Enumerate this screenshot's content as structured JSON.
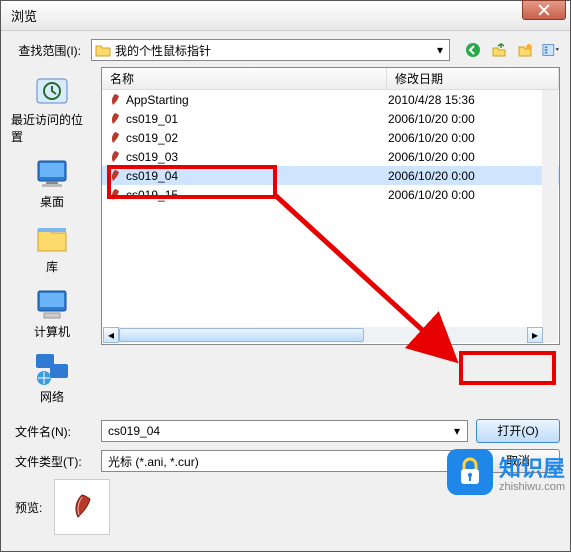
{
  "dialog": {
    "title": "浏览",
    "lookin_label": "查找范围(I):",
    "folder_name": "我的个性鼠标指针",
    "columns": {
      "name": "名称",
      "date": "修改日期"
    },
    "files": [
      {
        "name": "AppStarting",
        "date": "2010/4/28 15:36"
      },
      {
        "name": "cs019_01",
        "date": "2006/10/20 0:00"
      },
      {
        "name": "cs019_02",
        "date": "2006/10/20 0:00"
      },
      {
        "name": "cs019_03",
        "date": "2006/10/20 0:00"
      },
      {
        "name": "cs019_04",
        "date": "2006/10/20 0:00"
      },
      {
        "name": "cs019_15",
        "date": "2006/10/20 0:00"
      }
    ],
    "selected_index": 4,
    "filename_label": "文件名(N):",
    "filename_value": "cs019_04",
    "filetype_label": "文件类型(T):",
    "filetype_value": "光标 (*.ani, *.cur)",
    "open_label": "打开(O)",
    "cancel_label": "取消",
    "preview_label": "预览:"
  },
  "places": [
    {
      "key": "recent",
      "label": "最近访问的位置"
    },
    {
      "key": "desktop",
      "label": "桌面"
    },
    {
      "key": "library",
      "label": "库"
    },
    {
      "key": "computer",
      "label": "计算机"
    },
    {
      "key": "network",
      "label": "网络"
    }
  ],
  "nav_icons": [
    "back-icon",
    "up-icon",
    "new-folder-icon",
    "view-menu-icon"
  ],
  "watermark": {
    "brand": "知识屋",
    "url": "zhishiwu.com"
  },
  "colors": {
    "accent": "#1f87e8",
    "highlight": "#e60000",
    "selection": "#cfe5ff"
  }
}
